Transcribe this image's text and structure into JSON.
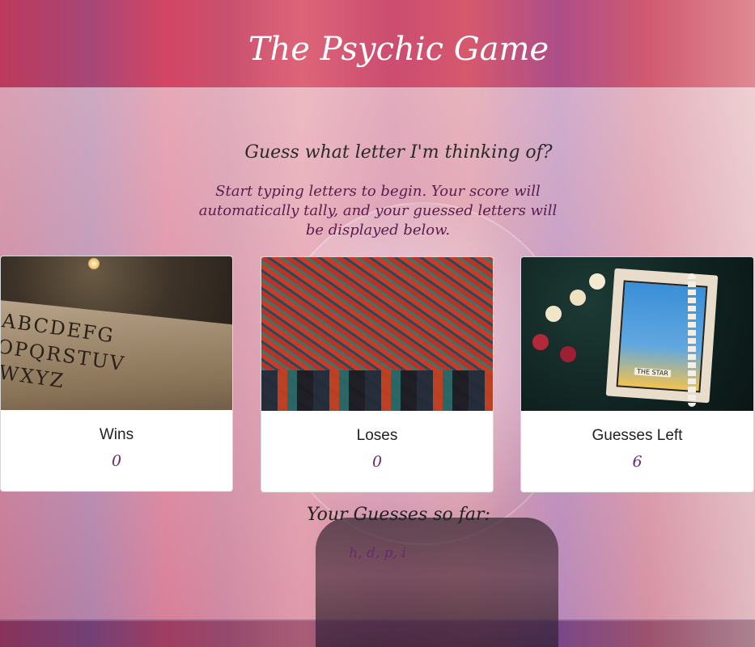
{
  "header": {
    "title": "The Psychic Game"
  },
  "main": {
    "prompt": "Guess what letter I'm thinking of?",
    "instructions": "Start typing letters to begin. Your score will automatically tally, and your guessed letters will be displayed below."
  },
  "cards": [
    {
      "title": "Wins",
      "value": "0",
      "image": "ouija-board"
    },
    {
      "title": "Loses",
      "value": "0",
      "image": "tarot-card-deck"
    },
    {
      "title": "Guesses Left",
      "value": "6",
      "image": "the-star-tarot-card"
    }
  ],
  "guesses": {
    "heading": "Your Guesses so far:",
    "letters": "h, d, p, i"
  },
  "colors": {
    "accent_text": "#6a2a6a",
    "instructions_text": "#5a1c50",
    "title_text": "#ffffff"
  }
}
